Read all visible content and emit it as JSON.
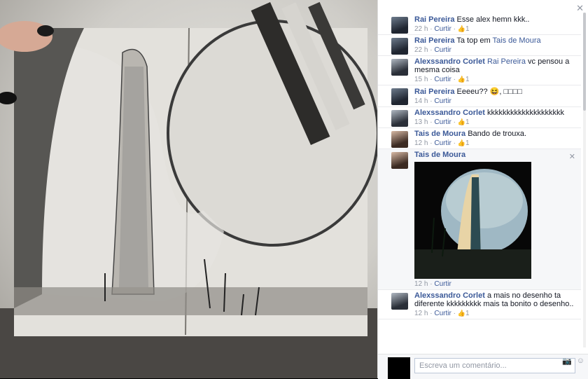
{
  "close_icon": "✕",
  "comments": [
    {
      "author": "Rai Pereira",
      "text": "Esse alex hemn kkk..",
      "mention": "",
      "rest": "",
      "time": "22 h",
      "action": "Curtir",
      "likes": "1"
    },
    {
      "author": "Rai Pereira",
      "text": "Ta top em ",
      "mention": "Tais de Moura",
      "rest": "",
      "time": "22 h",
      "action": "Curtir",
      "likes": ""
    },
    {
      "author": "Alexssandro Corlet",
      "text": "",
      "mention": "Rai Pereira",
      "rest": " vc pensou a mesma coisa",
      "time": "15 h",
      "action": "Curtir",
      "likes": "1"
    },
    {
      "author": "Rai Pereira",
      "text": "Eeeeu?? 😆, □□□□",
      "mention": "",
      "rest": "",
      "time": "14 h",
      "action": "Curtir",
      "likes": ""
    },
    {
      "author": "Alexssandro Corlet",
      "text": "kkkkkkkkkkkkkkkkkkkk",
      "mention": "",
      "rest": "",
      "time": "13 h",
      "action": "Curtir",
      "likes": "1"
    },
    {
      "author": "Tais de Moura",
      "text": "Bando de trouxa.",
      "mention": "",
      "rest": "",
      "time": "12 h",
      "action": "Curtir",
      "likes": "1"
    },
    {
      "author": "Tais de Moura",
      "text": "",
      "mention": "",
      "rest": "",
      "time": "12 h",
      "action": "Curtir",
      "likes": ""
    },
    {
      "author": "Alexssandro Corlet",
      "text": "a mais no desenho ta diferente kkkkkkkkk mais ta bonito o desenho..",
      "mention": "",
      "rest": "",
      "time": "12 h",
      "action": "Curtir",
      "likes": "1"
    }
  ],
  "dot": "·",
  "reply": {
    "placeholder": "Escreva um comentário..."
  }
}
